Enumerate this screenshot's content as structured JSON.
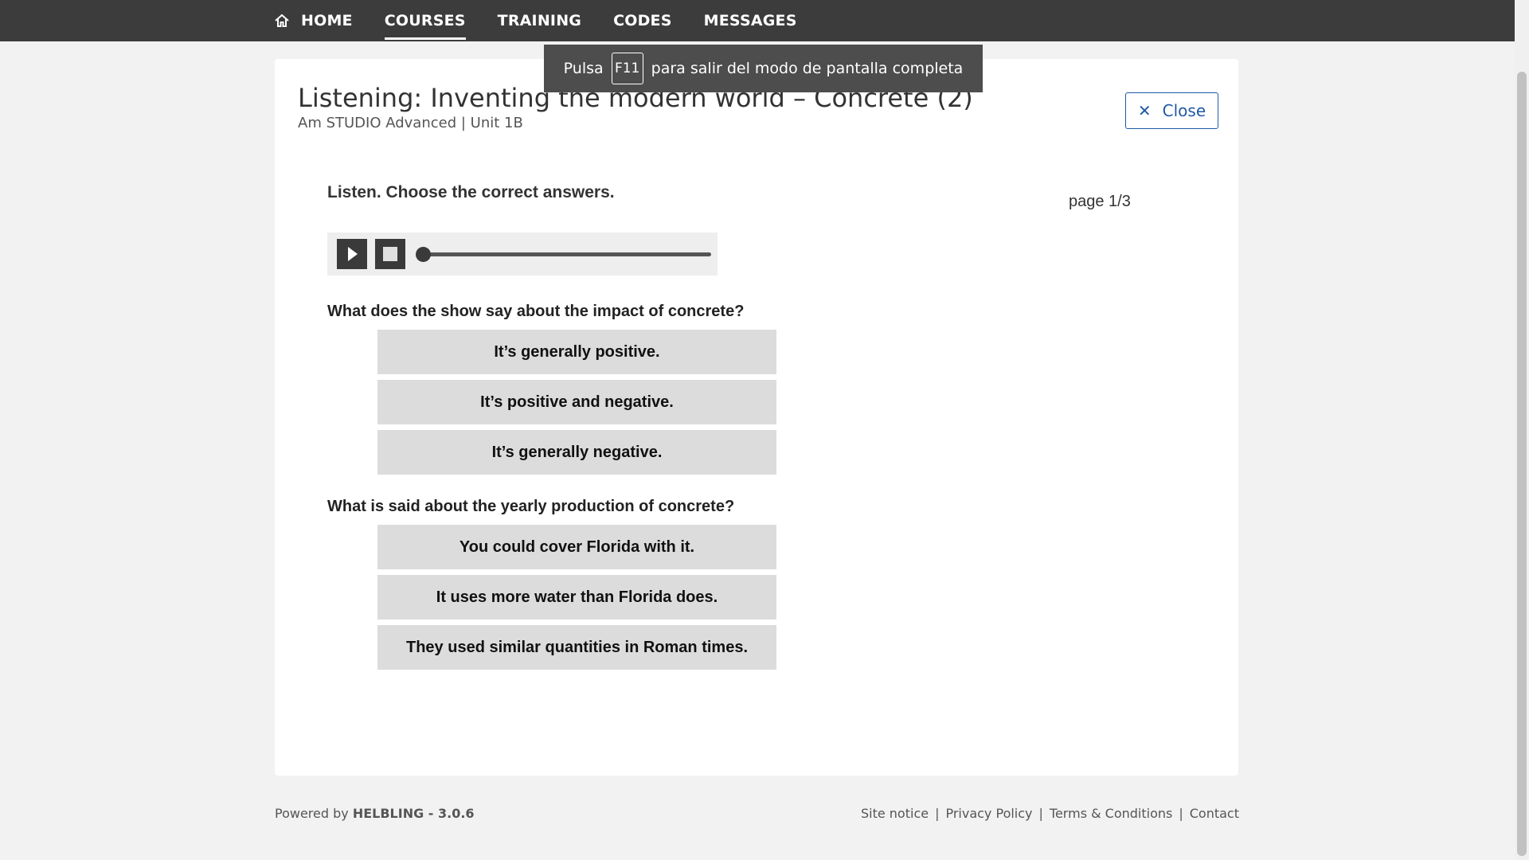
{
  "nav": {
    "items": [
      {
        "label": "HOME",
        "icon": "home-icon"
      },
      {
        "label": "COURSES",
        "active": true
      },
      {
        "label": "TRAINING"
      },
      {
        "label": "CODES"
      },
      {
        "label": "MESSAGES"
      }
    ]
  },
  "toast": {
    "before": "Pulsa",
    "key": "F11",
    "after": "para salir del modo de pantalla completa"
  },
  "card": {
    "title": "Listening: Inventing the modern world – Concrete (2)",
    "subtitle": "Am STUDIO Advanced | Unit 1B",
    "close_label": "Close"
  },
  "exercise": {
    "instruction": "Listen. Choose the correct answers.",
    "page": "page 1/3",
    "questions": [
      {
        "text": "What does the show say about the impact of concrete?",
        "options": [
          "It’s generally positive.",
          "It’s positive and negative.",
          "It’s generally negative."
        ]
      },
      {
        "text": "What is said about the yearly production of concrete?",
        "options": [
          "You could cover Florida with it.",
          "It uses more water than Florida does.",
          "They used similar quantities in Roman times."
        ]
      }
    ]
  },
  "player": {
    "progress": 0
  },
  "footer": {
    "powered_prefix": "Powered by",
    "powered_brand": "HELBLING - 3.0.6",
    "links": [
      "Site notice",
      "Privacy Policy",
      "Terms & Conditions",
      "Contact"
    ]
  }
}
